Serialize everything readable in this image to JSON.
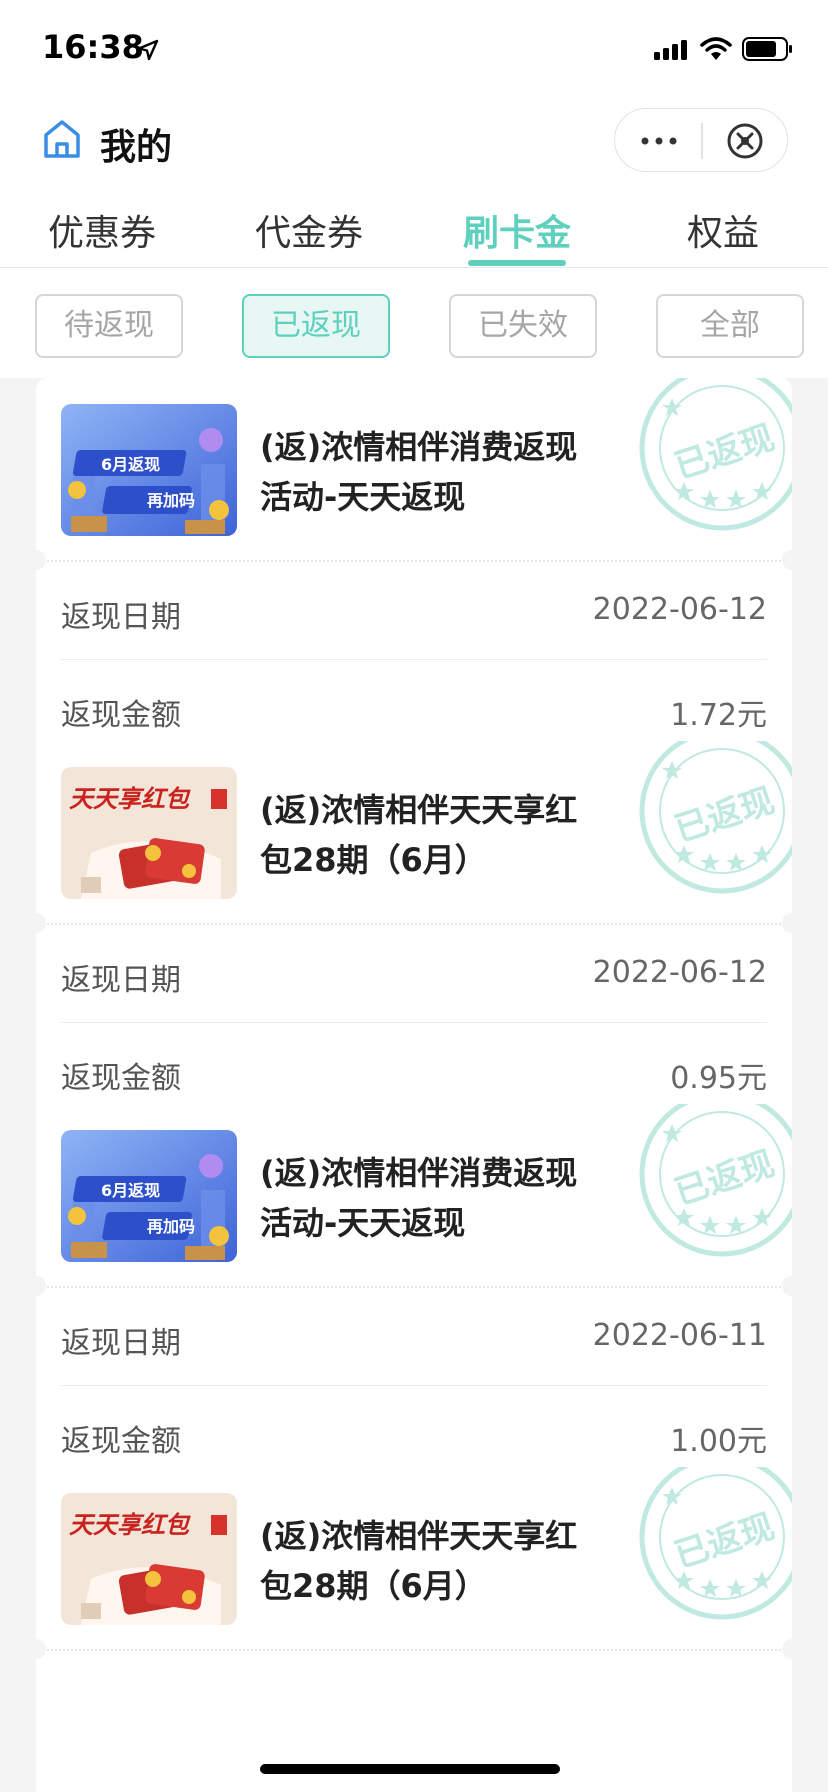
{
  "status": {
    "time": "16:38"
  },
  "nav": {
    "title": "我的"
  },
  "tabs": [
    {
      "label": "优惠券",
      "active": false
    },
    {
      "label": "代金券",
      "active": false
    },
    {
      "label": "刷卡金",
      "active": true
    },
    {
      "label": "权益",
      "active": false
    }
  ],
  "filters": [
    {
      "label": "待返现",
      "active": false
    },
    {
      "label": "已返现",
      "active": true
    },
    {
      "label": "已失效",
      "active": false
    },
    {
      "label": "全部",
      "active": false
    }
  ],
  "stamp_text": "已返现",
  "cards": [
    {
      "image": "6月返现再加码",
      "title": "(返)浓情相伴消费返现活动-天天返现",
      "date_label": "返现日期",
      "date": "2022-06-12",
      "amount_label": "返现金额",
      "amount": "1.72元"
    },
    {
      "image": "天天享红包",
      "title": "(返)浓情相伴天天享红包28期（6月）",
      "date_label": "返现日期",
      "date": "2022-06-12",
      "amount_label": "返现金额",
      "amount": "0.95元"
    },
    {
      "image": "6月返现再加码",
      "title": "(返)浓情相伴消费返现活动-天天返现",
      "date_label": "返现日期",
      "date": "2022-06-11",
      "amount_label": "返现金额",
      "amount": "1.00元"
    },
    {
      "image": "天天享红包",
      "title": "(返)浓情相伴天天享红包28期（6月）",
      "date_label": "",
      "date": "",
      "amount_label": "",
      "amount": ""
    }
  ],
  "colors": {
    "accent": "#5fcfbe",
    "accent_bg": "#e7f7f4",
    "stamp": "#bfe9e1"
  }
}
